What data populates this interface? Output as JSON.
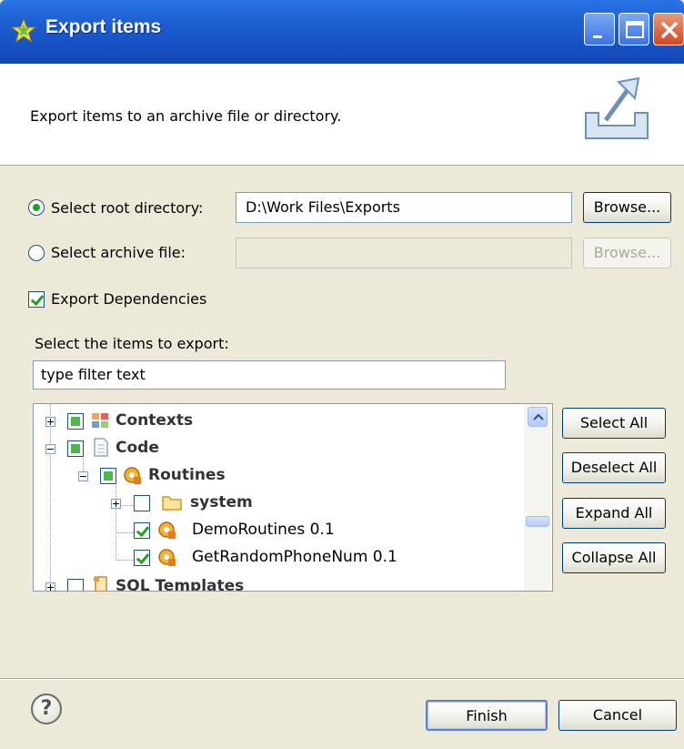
{
  "window": {
    "title": "Export items"
  },
  "banner": {
    "message": "Export items to an archive file or directory."
  },
  "options": {
    "root_dir_label": "Select root directory:",
    "root_dir_value": "D:\\Work Files\\Exports",
    "archive_label": "Select archive file:",
    "archive_value": "",
    "browse_label": "Browse...",
    "export_dependencies_label": "Export Dependencies",
    "export_dependencies_checked": true
  },
  "items": {
    "section_label": "Select the items to export:",
    "filter_value": "type filter text",
    "tree": [
      {
        "label": "Contexts",
        "state": "partial",
        "expanded": false,
        "icon": "contexts-icon"
      },
      {
        "label": "Code",
        "state": "partial",
        "expanded": true,
        "icon": "document-icon"
      },
      {
        "label": "Routines",
        "state": "partial",
        "expanded": true,
        "icon": "routine-icon"
      },
      {
        "label": "system",
        "state": "unchecked",
        "expanded": false,
        "icon": "folder-icon"
      },
      {
        "label": "DemoRoutines 0.1",
        "state": "checked",
        "icon": "routine-icon"
      },
      {
        "label": "GetRandomPhoneNum 0.1",
        "state": "checked",
        "icon": "routine-icon"
      },
      {
        "label": "SQL Templates",
        "state": "unchecked",
        "expanded": false,
        "icon": "sql-templates-icon"
      }
    ]
  },
  "side_buttons": {
    "select_all": "Select All",
    "deselect_all": "Deselect All",
    "expand_all": "Expand All",
    "collapse_all": "Collapse All"
  },
  "footer": {
    "help": "?",
    "finish": "Finish",
    "cancel": "Cancel"
  },
  "colors": {
    "titlebar": "#1e5fd1",
    "check_green": "#21a121",
    "dialog_bg": "#ece9d8"
  }
}
